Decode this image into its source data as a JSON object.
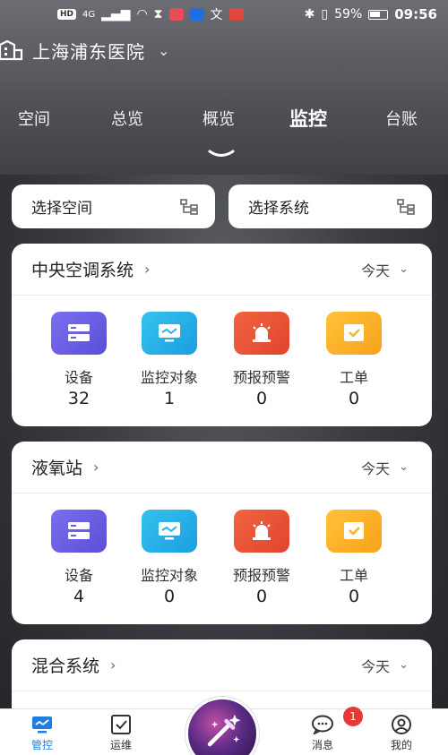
{
  "status_bar": {
    "network_chip": "HD",
    "signal": "4G",
    "battery_percent": "59%",
    "time": "09:56"
  },
  "header": {
    "hospital_name": "上海浦东医院"
  },
  "top_tabs": [
    {
      "label": "空间"
    },
    {
      "label": "总览"
    },
    {
      "label": "概览"
    },
    {
      "label": "监控",
      "active": true
    },
    {
      "label": "台账"
    }
  ],
  "selectors": {
    "space_label": "选择空间",
    "system_label": "选择系统"
  },
  "cards": [
    {
      "title": "中央空调系统",
      "range": "今天",
      "stats": [
        {
          "label": "设备",
          "value": "32"
        },
        {
          "label": "监控对象",
          "value": "1"
        },
        {
          "label": "预报预警",
          "value": "0"
        },
        {
          "label": "工单",
          "value": "0"
        }
      ]
    },
    {
      "title": "液氧站",
      "range": "今天",
      "stats": [
        {
          "label": "设备",
          "value": "4"
        },
        {
          "label": "监控对象",
          "value": "0"
        },
        {
          "label": "预报预警",
          "value": "0"
        },
        {
          "label": "工单",
          "value": "0"
        }
      ]
    },
    {
      "title": "混合系统",
      "range": "今天"
    }
  ],
  "bottom_nav": [
    {
      "label": "管控",
      "icon": "monitor-icon",
      "active": true
    },
    {
      "label": "运维",
      "icon": "checkbox-icon"
    },
    {
      "label": "消息",
      "icon": "chat-icon",
      "badge": "1"
    },
    {
      "label": "我的",
      "icon": "user-icon"
    }
  ],
  "colors": {
    "accent": "#1f7fe0",
    "device_icon": "#6a5ee6",
    "monitor_icon": "#29b3ea",
    "alarm_icon": "#ea5436",
    "order_icon": "#fbb22c",
    "badge": "#e53935"
  }
}
